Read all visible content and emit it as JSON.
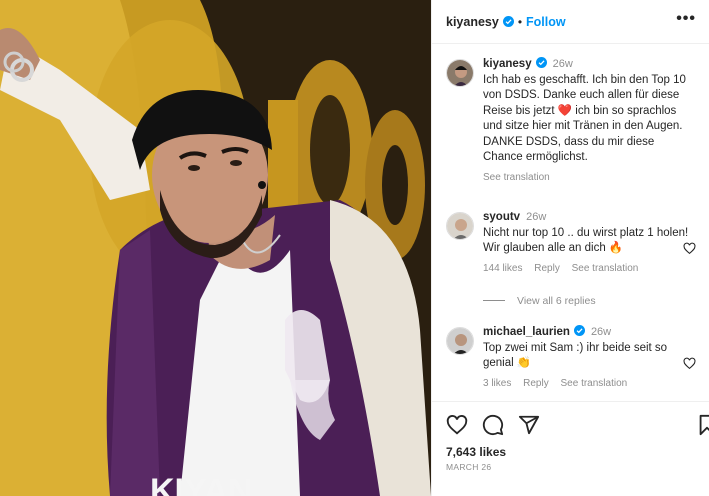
{
  "post": {
    "author": "kiyanesy",
    "follow_label": "Follow",
    "more_label": "•••",
    "image_caption_text": "KIYAN"
  },
  "caption": {
    "author": "kiyanesy",
    "time": "26w",
    "text": "Ich hab es geschafft. Ich bin den Top 10 von DSDS. Danke euch allen für diese Reise bis jetzt ❤️ ich bin so sprachlos und sitze hier mit Tränen in den Augen. DANKE DSDS, dass du mir diese Chance ermöglichst.",
    "see_translation": "See translation"
  },
  "comments": [
    {
      "author": "syoutv",
      "time": "26w",
      "text": "Nicht nur top 10 .. du wirst platz 1 holen! Wir glauben alle an dich 🔥",
      "likes": "144 likes",
      "reply": "Reply",
      "see_translation": "See translation"
    },
    {
      "author": "michael_laurien",
      "time": "26w",
      "text": "Top zwei mit Sam :) ihr beide seit so genial 👏",
      "likes": "3 likes",
      "reply": "Reply",
      "see_translation": "See translation"
    }
  ],
  "view_replies": "View all 6 replies",
  "footer": {
    "likes": "7,643 likes",
    "date": "MARCH 26"
  },
  "colors": {
    "accent": "#0095f6",
    "muted": "#8e8e8e",
    "heart": "#ed4956"
  }
}
